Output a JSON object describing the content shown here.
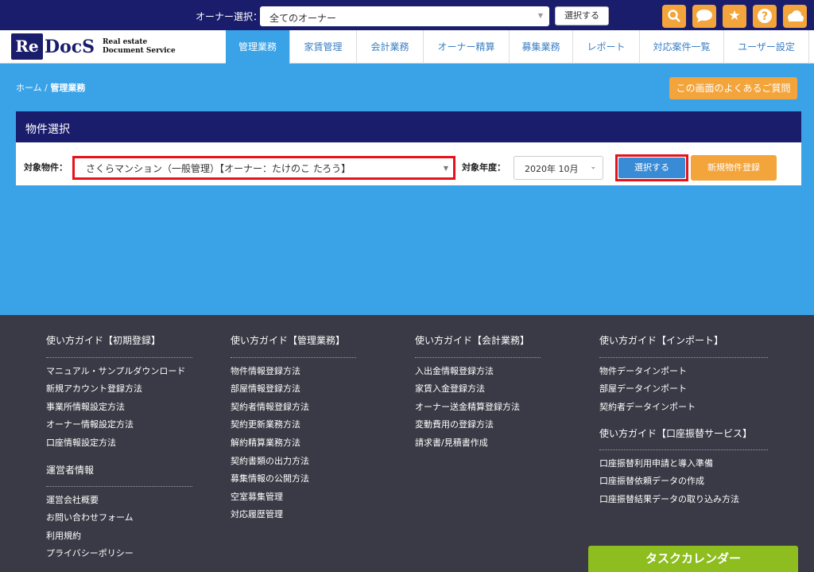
{
  "topbar": {
    "owner_label": "オーナー選択：",
    "owner_value": "全てのオーナー",
    "select_button": "選択する",
    "icons": [
      "search-icon",
      "chat-icon",
      "star-icon",
      "help-icon",
      "cloud-icon"
    ]
  },
  "logo": {
    "re": "Re",
    "docs": "DocS",
    "sub1": "Real estate",
    "sub2": "Document Service"
  },
  "nav": {
    "tabs": [
      {
        "label": "管理業務"
      },
      {
        "label": "家賃管理"
      },
      {
        "label": "会計業務"
      },
      {
        "label": "オーナー精算"
      },
      {
        "label": "募集業務"
      },
      {
        "label": "レポート"
      },
      {
        "label": "対応案件一覧"
      },
      {
        "label": "ユーザー設定"
      }
    ]
  },
  "breadcrumb": {
    "home": "ホーム",
    "sep": "/",
    "current": "管理業務"
  },
  "faq_button": "この画面のよくあるご質問",
  "panel": {
    "title": "物件選択",
    "property_label": "対象物件：",
    "property_value": "さくらマンション（一般管理）【オーナー：たけのこ たろう】",
    "year_label": "対象年度：",
    "year_value": "2020年 10月",
    "select_button": "選択する",
    "new_button": "新規物件登録"
  },
  "footer": {
    "col1": {
      "title": "使い方ガイド【初期登録】",
      "links": [
        "マニュアル・サンプルダウンロード",
        "新規アカウント登録方法",
        "事業所情報設定方法",
        "オーナー情報設定方法",
        "口座情報設定方法"
      ],
      "title2": "運営者情報",
      "links2": [
        "運営会社概要",
        "お問い合わせフォーム",
        "利用規約",
        "プライバシーポリシー"
      ]
    },
    "col2": {
      "title": "使い方ガイド【管理業務】",
      "links": [
        "物件情報登録方法",
        "部屋情報登録方法",
        "契約者情報登録方法",
        "契約更新業務方法",
        "解約精算業務方法",
        "契約書類の出力方法",
        "募集情報の公開方法",
        "空室募集管理",
        "対応履歴管理"
      ]
    },
    "col3": {
      "title": "使い方ガイド【会計業務】",
      "links": [
        "入出金情報登録方法",
        "家賃入金登録方法",
        "オーナー送金精算登録方法",
        "変動費用の登録方法",
        "請求書/見積書作成"
      ]
    },
    "col4": {
      "title": "使い方ガイド【インポート】",
      "links": [
        "物件データインポート",
        "部屋データインポート",
        "契約者データインポート"
      ],
      "title2": "使い方ガイド【口座振替サービス】",
      "links2": [
        "口座振替利用申請と導入準備",
        "口座振替依頼データの作成",
        "口座振替結果データの取り込み方法"
      ]
    },
    "task_button": "タスクカレンダー"
  }
}
